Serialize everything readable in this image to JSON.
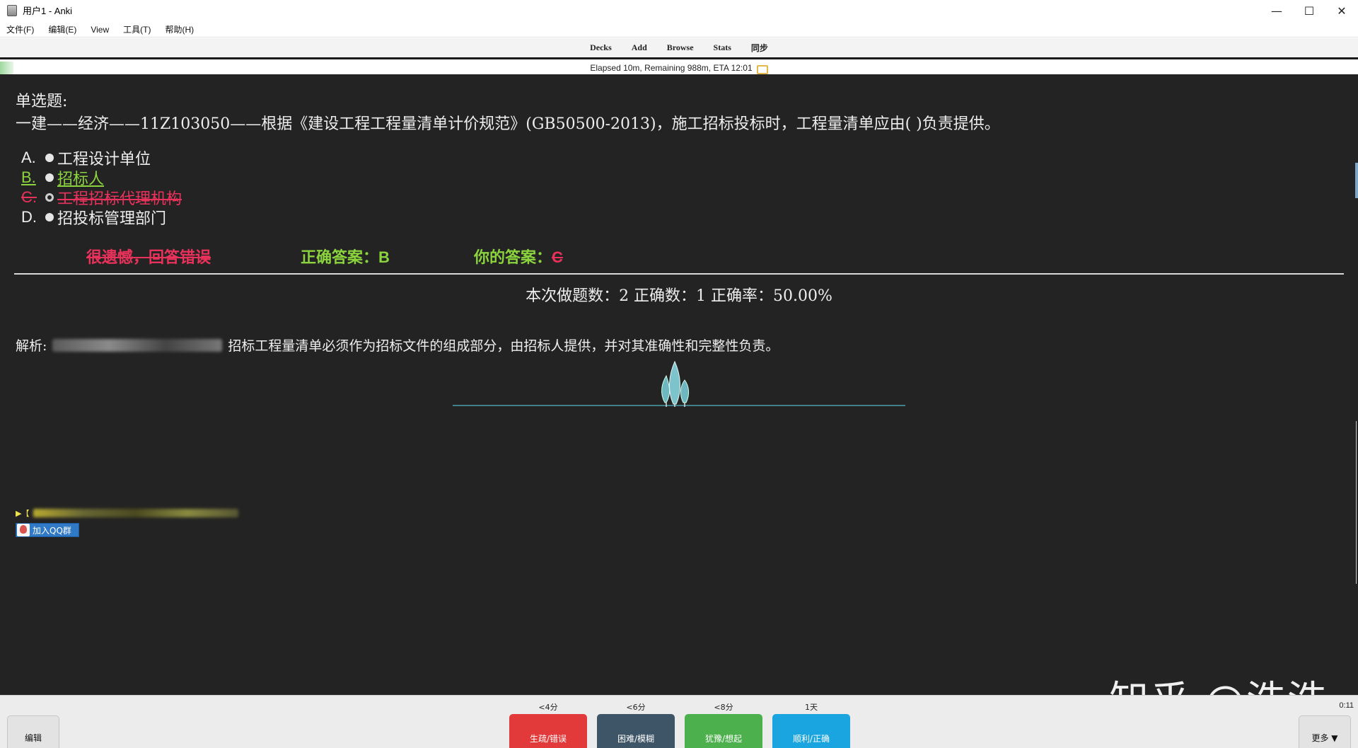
{
  "window": {
    "title": "用户1 - Anki",
    "controls": {
      "minimize": "—",
      "maximize": "☐",
      "close": "✕"
    }
  },
  "menu": {
    "items": [
      "文件(F)",
      "编辑(E)",
      "View",
      "工具(T)",
      "帮助(H)"
    ]
  },
  "toolbar": {
    "items": [
      "Decks",
      "Add",
      "Browse",
      "Stats",
      "同步"
    ]
  },
  "progress": {
    "text": "Elapsed 10m, Remaining 988m, ETA 12:01",
    "fraction": 0.01
  },
  "card": {
    "question_type": "单选题:",
    "question": "一建——经济——11Z103050——根据《建设工程工程量清单计价规范》(GB50500-2013)，施工招标投标时，工程量清单应由( )负责提供。",
    "options": [
      {
        "letter": "A.",
        "text": "工程设计单位",
        "state": "normal"
      },
      {
        "letter": "B.",
        "text": "招标人",
        "state": "correct"
      },
      {
        "letter": "C.",
        "text": "工程招标代理机构",
        "state": "wrong"
      },
      {
        "letter": "D.",
        "text": "招投标管理部门",
        "state": "normal"
      }
    ],
    "verdict": "很遗憾，回答错误",
    "correct_label": "正确答案：",
    "correct_value": "B",
    "your_label": "你的答案：",
    "your_value": "C",
    "stats_line": "本次做题数：2 正确数：1 正确率：50.00%",
    "analysis_label": "解析:",
    "analysis_text": "招标工程量清单必须作为招标文件的组成部分，由招标人提供，并对其准确性和完整性负责。",
    "promo_prefix": "▶【",
    "qq_button": "加入QQ群"
  },
  "answer_buttons": [
    {
      "time": "<4分",
      "label": "生疏/错误",
      "color": "#e23a3a"
    },
    {
      "time": "<6分",
      "label": "困难/模糊",
      "color": "#3d5566"
    },
    {
      "time": "<8分",
      "label": "犹豫/想起",
      "color": "#4cb04c"
    },
    {
      "time": "1天",
      "label": "顺利/正确",
      "color": "#1aa4e0"
    }
  ],
  "bottom": {
    "edit": "编辑",
    "more": "更多 ▼",
    "timer": "0:11"
  },
  "watermark": "知乎 @浩浩"
}
